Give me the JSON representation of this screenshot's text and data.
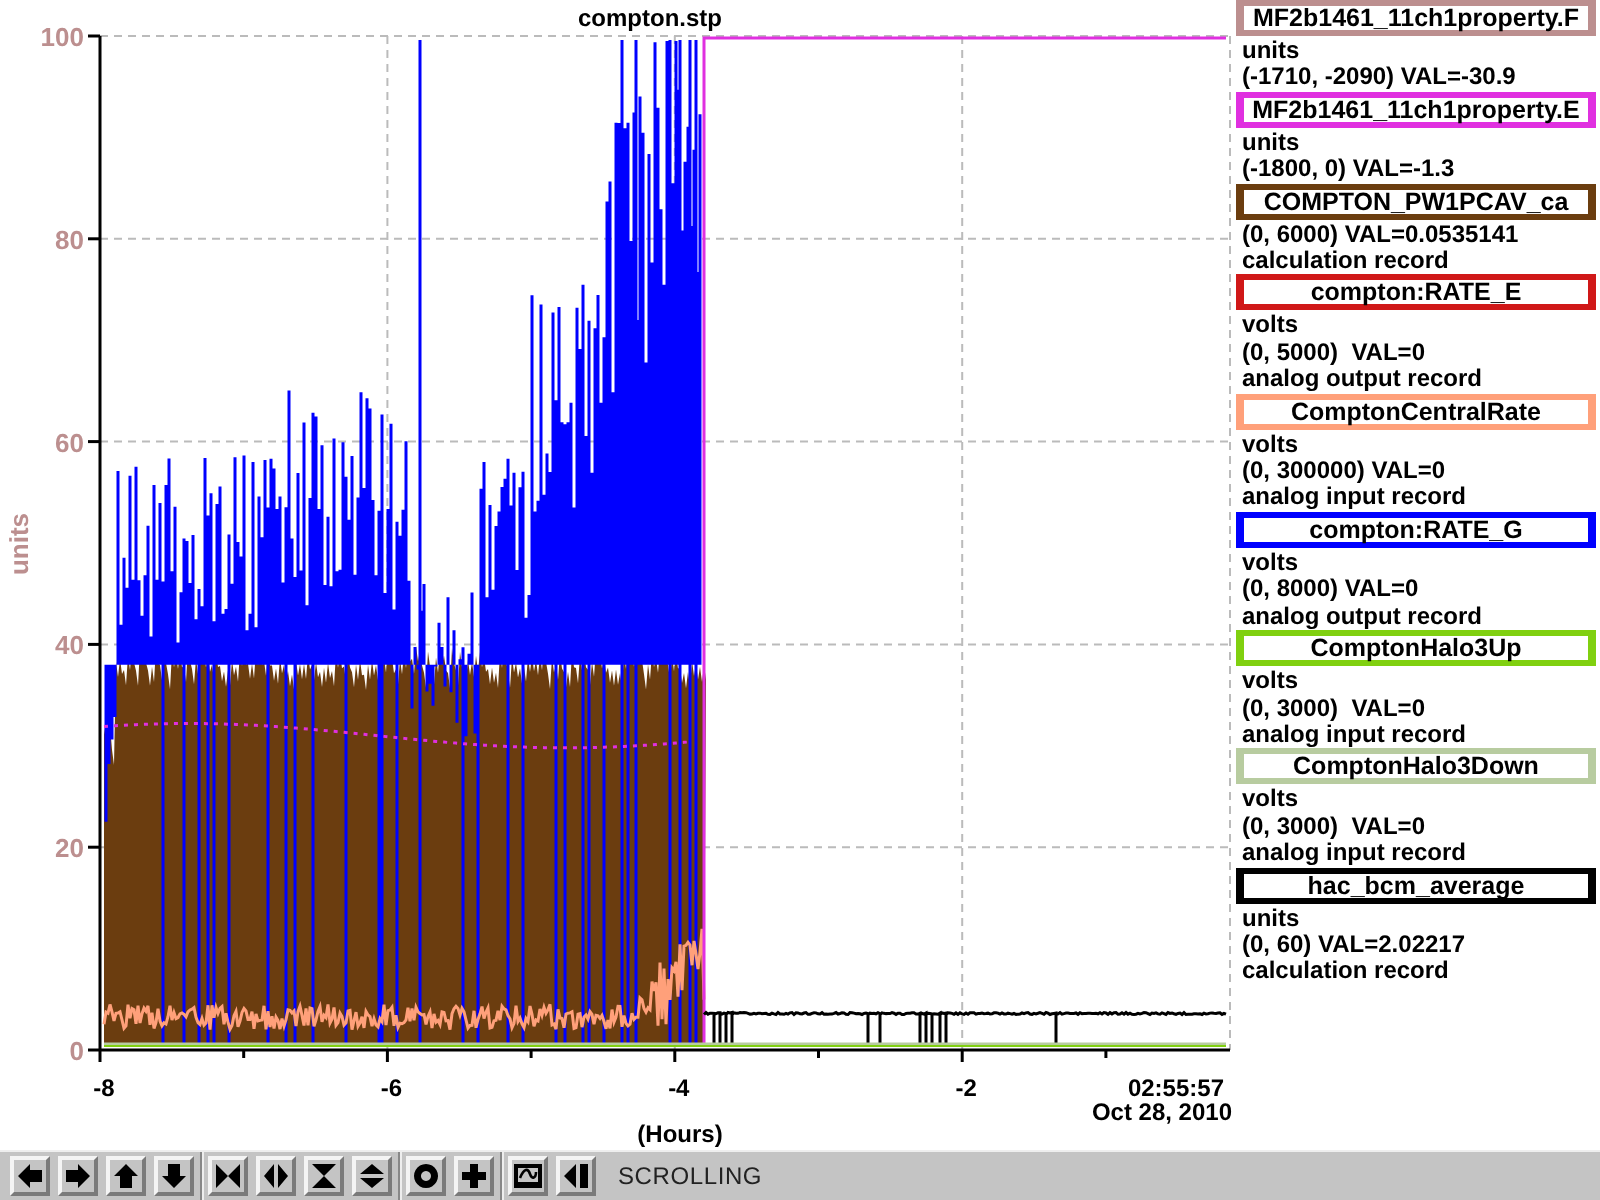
{
  "plot": {
    "title": "compton.stp",
    "y_axis": {
      "label": "units",
      "ticks": [
        "100",
        "80",
        "60",
        "40",
        "20",
        "0"
      ]
    },
    "x_axis": {
      "label": "(Hours)",
      "ticks": [
        "-8",
        "-6",
        "-4",
        "-2"
      ],
      "end_time": "02:55:57",
      "end_date": "Oct 28, 2010"
    }
  },
  "legend": [
    {
      "name": "MF2b1461_11ch1property.F",
      "color": "#bc8f8f",
      "lines": [
        "units",
        "(-1710, -2090) VAL=-30.9"
      ]
    },
    {
      "name": "MF2b1461_11ch1property.E",
      "color": "#e030e0",
      "lines": [
        "units",
        "(-1800, 0) VAL=-1.3"
      ]
    },
    {
      "name": "COMPTON_PW1PCAV_ca",
      "color": "#6b3d0f",
      "lines": [
        "(0, 6000) VAL=0.0535141",
        "calculation record"
      ]
    },
    {
      "name": "compton:RATE_E",
      "color": "#d01818",
      "lines": [
        "volts",
        "(0, 5000)  VAL=0",
        "analog output record"
      ]
    },
    {
      "name": "ComptonCentralRate",
      "color": "#ffa07a",
      "lines": [
        "volts",
        "(0, 300000) VAL=0",
        "analog input record"
      ]
    },
    {
      "name": "compton:RATE_G",
      "color": "#0000ff",
      "lines": [
        "volts",
        "(0, 8000) VAL=0",
        "analog output record"
      ]
    },
    {
      "name": "ComptonHalo3Up",
      "color": "#80d010",
      "lines": [
        "volts",
        "(0, 3000)  VAL=0",
        "analog input record"
      ]
    },
    {
      "name": "ComptonHalo3Down",
      "color": "#b8cca0",
      "lines": [
        "volts",
        "(0, 3000)  VAL=0",
        "analog input record"
      ]
    },
    {
      "name": "hac_bcm_average",
      "color": "#000000",
      "lines": [
        "units",
        "(0, 60) VAL=2.02217",
        "calculation record"
      ]
    }
  ],
  "toolbar": {
    "groups": [
      [
        {
          "kind": "pan-left"
        },
        {
          "kind": "pan-right"
        },
        {
          "kind": "pan-up"
        },
        {
          "kind": "pan-down"
        }
      ],
      [
        {
          "kind": "zoom-in-x"
        },
        {
          "kind": "zoom-out-x"
        },
        {
          "kind": "zoom-in-y"
        },
        {
          "kind": "zoom-out-y"
        }
      ],
      [
        {
          "kind": "ring"
        },
        {
          "kind": "plus"
        }
      ],
      [
        {
          "kind": "graph"
        },
        {
          "kind": "jump-end"
        }
      ]
    ],
    "status": "SCROLLING"
  }
}
